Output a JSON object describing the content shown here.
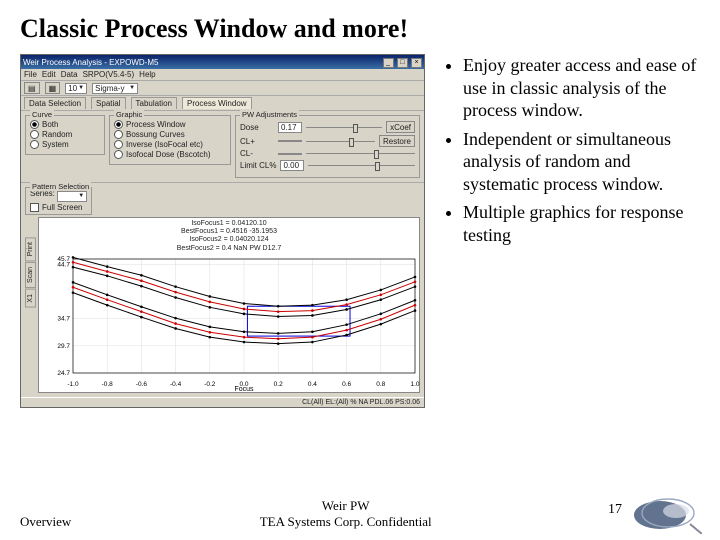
{
  "slide": {
    "title": "Classic Process Window and more!",
    "bullets": [
      "Enjoy greater access and ease of use in classic analysis of the process window.",
      "Independent or simultaneous analysis of random and systematic process window.",
      "Multiple graphics for response testing"
    ],
    "footer_left": "Overview",
    "footer_center_line1": "Weir PW",
    "footer_center_line2": "TEA Systems Corp. Confidential",
    "page_number": "17"
  },
  "app": {
    "title": "Weir Process Analysis - EXPOWD-M5",
    "menus": [
      "File",
      "Edit",
      "Data",
      "SRPO(V5.4-5)",
      "Help"
    ],
    "toolbar_value": "10",
    "toolbar_dropdown": "Sigma-y",
    "tabs": [
      "Data Selection",
      "Spatial",
      "Tabulation",
      "Process Window"
    ],
    "active_tab": 3,
    "section_label": "Process Window",
    "curve_group": {
      "label": "Curve",
      "options": [
        "Both",
        "Random",
        "System"
      ],
      "selected": 0
    },
    "graphic_group": {
      "label": "Graphic",
      "options": [
        "Process Window",
        "Bossung Curves",
        "Inverse (IsoFocal etc)",
        "Isofocal Dose (Bscotch)"
      ],
      "selected": 0
    },
    "adjust": {
      "label": "PW Adjustments",
      "rows": [
        {
          "name": "Dose",
          "value": "0.17",
          "extra": "xCoef"
        },
        {
          "name": "CL+",
          "value": "",
          "extra": "Restore"
        },
        {
          "name": "CL-",
          "value": ""
        },
        {
          "name": "Limit CL%",
          "value": "0.00"
        }
      ]
    },
    "plot_control": {
      "label": "Pattern Selection",
      "series_lbl": "Series:",
      "full_screen": "Full Screen"
    },
    "plot_title_lines": [
      "IsoFocus1    = 0.04120.10",
      "BestFocus1  = 0.4516 -35.1953",
      "IsoFocus2    = 0.04020.124",
      "BestFocus2  = 0.4 NaN PW D12.7"
    ],
    "status": "CL(All)  EL:(All)  %   NA   PDL.06  PS:0.06",
    "side_tabs": [
      "Print",
      "Scan",
      "X1"
    ]
  },
  "chart_data": {
    "type": "line",
    "xlabel": "Focus",
    "ylabel": "",
    "xlim": [
      -1.0,
      1.0
    ],
    "ylim": [
      24.7,
      45.7
    ],
    "xticks": [
      -1.0,
      -0.8,
      -0.6,
      -0.4,
      -0.2,
      0.0,
      0.2,
      0.4,
      0.6,
      0.8,
      1.0
    ],
    "yticks": [
      24.7,
      29.7,
      34.7,
      44.7,
      45.7
    ],
    "bestfocus_a": 0.4516,
    "bestfocus_b": 0.4,
    "window_box": {
      "x0": 0.02,
      "x1": 0.62,
      "y0": 31.5,
      "y1": 37.0
    },
    "series": [
      {
        "name": "upper-black-1",
        "color": "#000",
        "x": [
          -1.0,
          -0.8,
          -0.6,
          -0.4,
          -0.2,
          0.0,
          0.2,
          0.4,
          0.6,
          0.8,
          1.0
        ],
        "y": [
          46,
          44.3,
          42.7,
          40.6,
          38.8,
          37.5,
          37.0,
          37.2,
          38.2,
          40.0,
          42.4
        ]
      },
      {
        "name": "upper-black-2",
        "color": "#000",
        "x": [
          -1.0,
          -0.8,
          -0.6,
          -0.4,
          -0.2,
          0.0,
          0.2,
          0.4,
          0.6,
          0.8,
          1.0
        ],
        "y": [
          44.2,
          42.6,
          40.7,
          38.6,
          36.8,
          35.6,
          35.1,
          35.3,
          36.4,
          38.2,
          40.6
        ]
      },
      {
        "name": "upper-red",
        "color": "#c00",
        "x": [
          -1.0,
          -0.8,
          -0.6,
          -0.4,
          -0.2,
          0.0,
          0.2,
          0.4,
          0.6,
          0.8,
          1.0
        ],
        "y": [
          45.1,
          43.4,
          41.7,
          39.6,
          37.8,
          36.5,
          36.0,
          36.2,
          37.3,
          39.1,
          41.5
        ]
      },
      {
        "name": "lower-red",
        "color": "#c00",
        "x": [
          -1.0,
          -0.8,
          -0.6,
          -0.4,
          -0.2,
          0.0,
          0.2,
          0.4,
          0.6,
          0.8,
          1.0
        ],
        "y": [
          40.5,
          38.2,
          36.0,
          33.8,
          32.2,
          31.3,
          31.0,
          31.3,
          32.6,
          34.6,
          37.2
        ]
      },
      {
        "name": "lower-black-1",
        "color": "#000",
        "x": [
          -1.0,
          -0.8,
          -0.6,
          -0.4,
          -0.2,
          0.0,
          0.2,
          0.4,
          0.6,
          0.8,
          1.0
        ],
        "y": [
          41.4,
          39.1,
          36.9,
          34.8,
          33.2,
          32.3,
          32.0,
          32.3,
          33.6,
          35.6,
          38.1
        ]
      },
      {
        "name": "lower-black-2",
        "color": "#000",
        "x": [
          -1.0,
          -0.8,
          -0.6,
          -0.4,
          -0.2,
          0.0,
          0.2,
          0.4,
          0.6,
          0.8,
          1.0
        ],
        "y": [
          39.5,
          37.2,
          35.0,
          32.9,
          31.3,
          30.4,
          30.1,
          30.4,
          31.7,
          33.7,
          36.2
        ]
      }
    ]
  }
}
